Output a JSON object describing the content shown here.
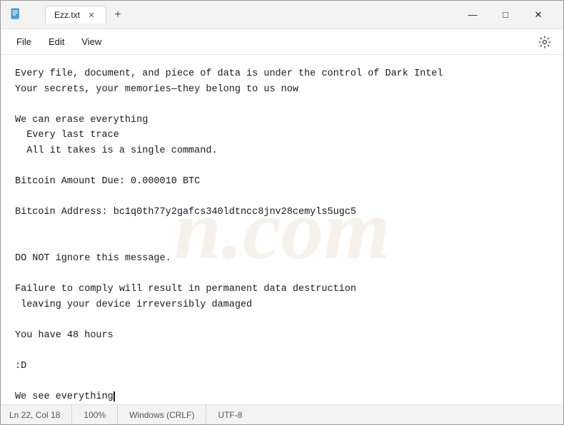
{
  "window": {
    "title": "Ezz.txt",
    "tab_label": "Ezz.txt"
  },
  "menu": {
    "file": "File",
    "edit": "Edit",
    "view": "View"
  },
  "window_controls": {
    "minimize": "—",
    "maximize": "□",
    "close": "✕"
  },
  "editor": {
    "content": "Every file, document, and piece of data is under the control of Dark Intel\nYour secrets, your memories—they belong to us now\n\nWe can erase everything\n  Every last trace\n  All it takes is a single command.\n\nBitcoin Amount Due: 0.000010 BTC\n\nBitcoin Address: bc1q0th77y2gafcs340ldtncc8jnv28cemyls5ugc5\n\n\nDO NOT ignore this message.\n\nFailure to comply will result in permanent data destruction\n leaving your device irreversibly damaged\n\nYou have 48 hours\n\n:D\n\nWe see everything"
  },
  "status_bar": {
    "position": "Ln 22, Col 18",
    "zoom": "100%",
    "line_ending": "Windows (CRLF)",
    "encoding": "UTF-8"
  },
  "watermark": {
    "text": "n.com"
  }
}
